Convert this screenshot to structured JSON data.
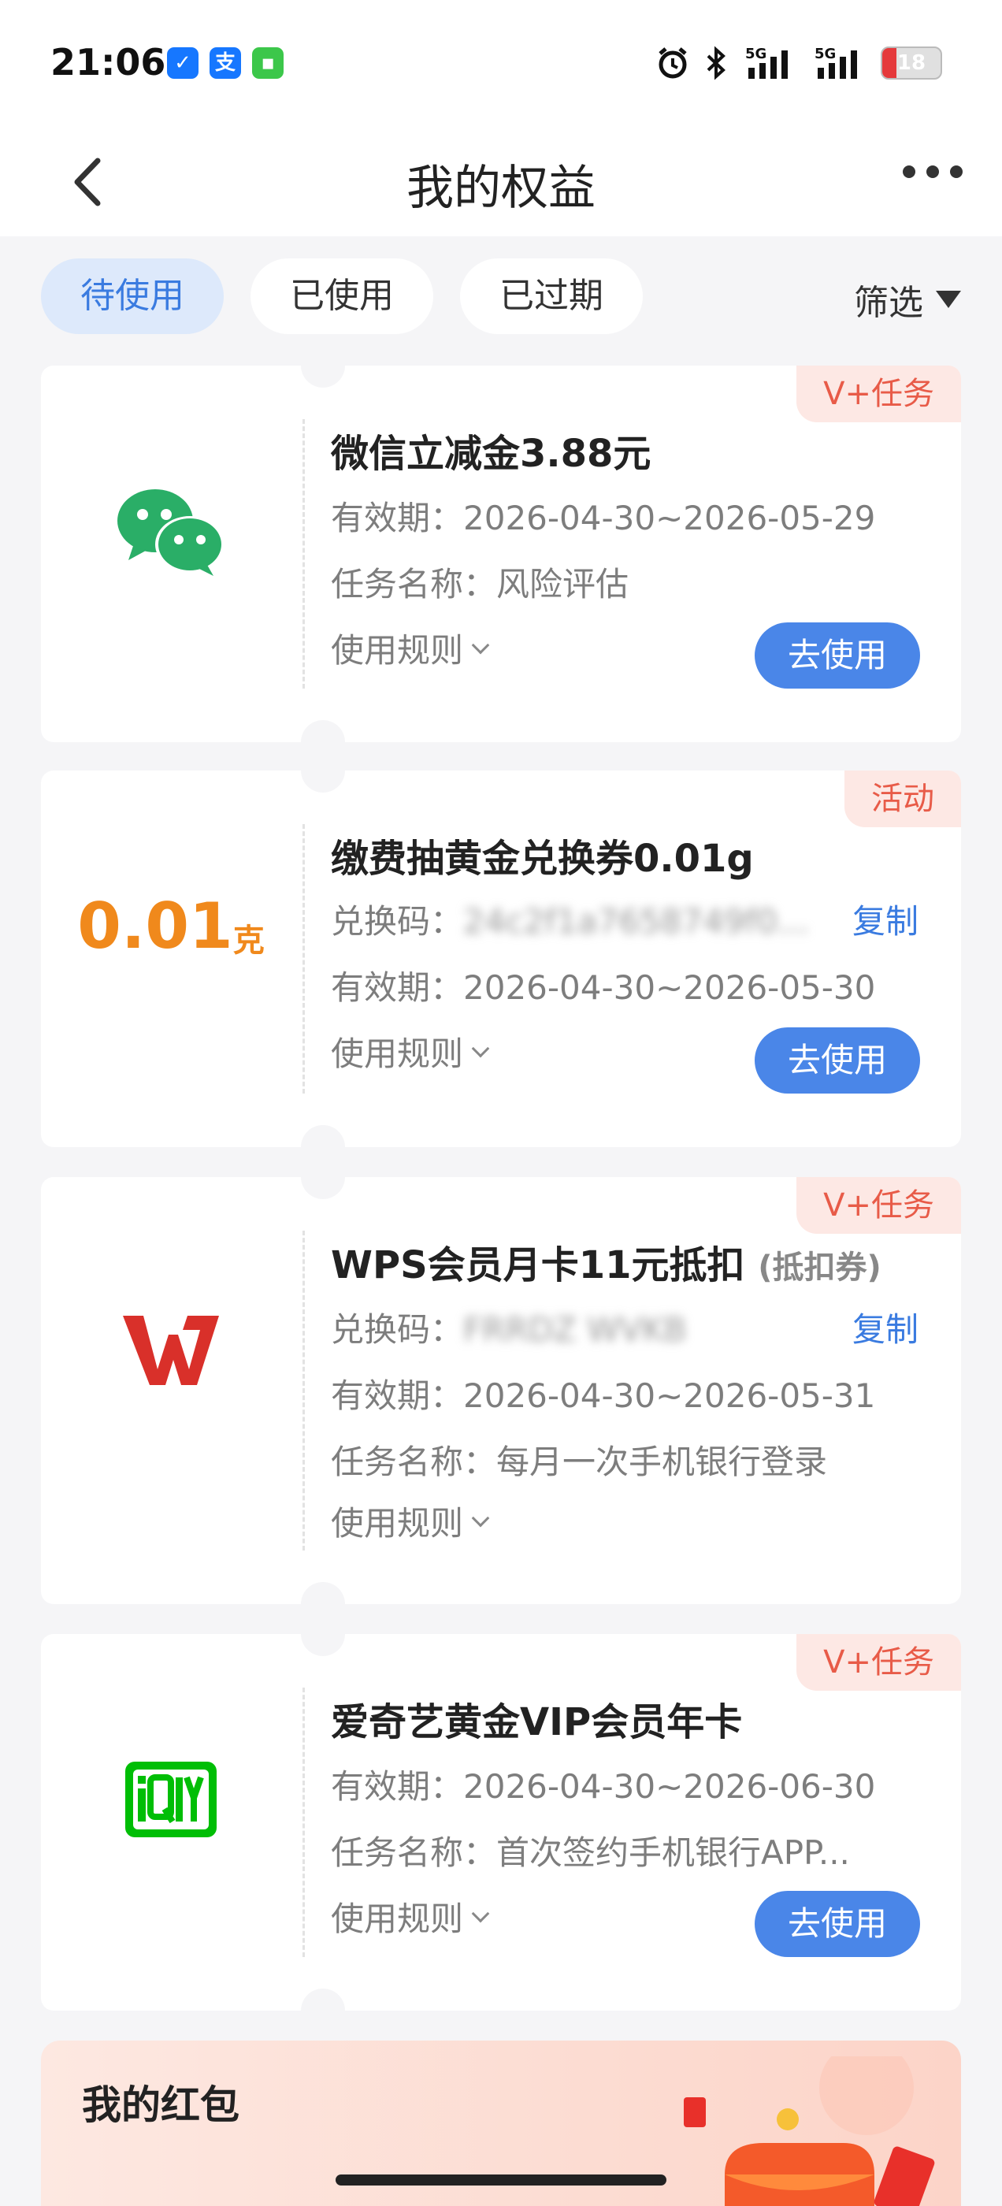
{
  "status_bar": {
    "time": "21:06",
    "battery": "18",
    "network1": "5G",
    "network2": "5G"
  },
  "header": {
    "title": "我的权益"
  },
  "tabs": [
    {
      "label": "待使用",
      "active": true
    },
    {
      "label": "已使用",
      "active": false
    },
    {
      "label": "已过期",
      "active": false
    }
  ],
  "filter_label": "筛选",
  "cards": [
    {
      "tag": "V+任务",
      "title": "微信立减金3.88元",
      "validity": "有效期：2026-04-30~2026-05-29",
      "task": "任务名称：风险评估",
      "rules": "使用规则",
      "button": "去使用"
    },
    {
      "tag": "活动",
      "logo_value": "0.01",
      "logo_unit": "克",
      "title": "缴费抽黄金兑换券0.01g",
      "code_label": "兑换码：",
      "code_value": "24c2f1a7658749f0...",
      "copy": "复制",
      "validity": "有效期：2026-04-30~2026-05-30",
      "rules": "使用规则",
      "button": "去使用"
    },
    {
      "tag": "V+任务",
      "title": "WPS会员月卡11元抵扣",
      "title_note": "(抵扣券)",
      "code_label": "兑换码：",
      "code_value": "FRRDZ WVKB",
      "copy": "复制",
      "validity": "有效期：2026-04-30~2026-05-31",
      "task": "任务名称：每月一次手机银行登录",
      "rules": "使用规则"
    },
    {
      "tag": "V+任务",
      "title": "爱奇艺黄金VIP会员年卡",
      "validity": "有效期：2026-04-30~2026-06-30",
      "task": "任务名称：首次签约手机银行APP...",
      "rules": "使用规则",
      "button": "去使用"
    }
  ],
  "red_packet": {
    "title": "我的红包"
  },
  "colors": {
    "accent": "#4a86e8",
    "tag": "#e85b48",
    "gold": "#f0891c",
    "wechat": "#2aae67",
    "wps": "#d9302a",
    "iqiyi": "#00be06"
  }
}
